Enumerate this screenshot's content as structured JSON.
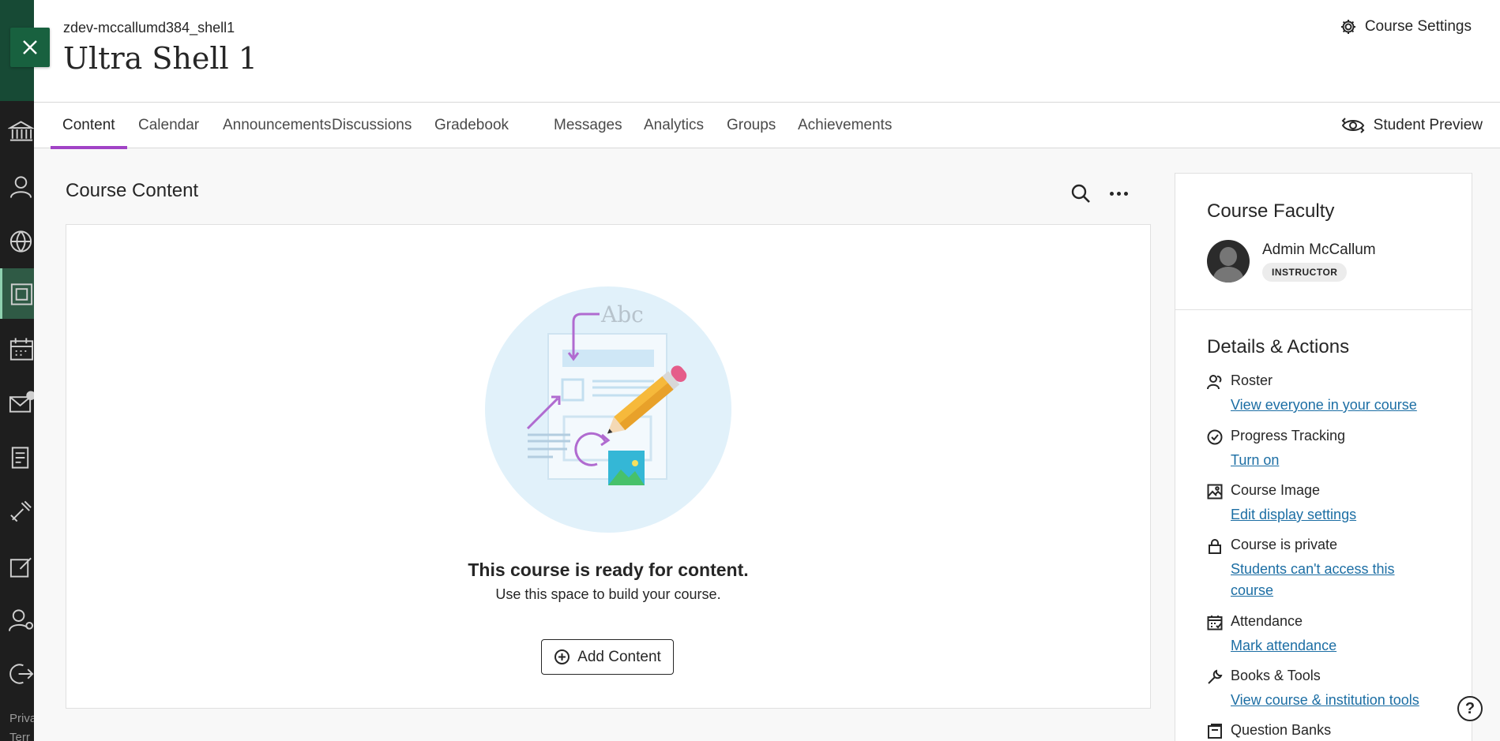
{
  "header": {
    "course_id": "zdev-mccallumd384_shell1",
    "course_title": "Ultra Shell 1",
    "settings_label": "Course Settings"
  },
  "tabs": [
    {
      "label": "Content",
      "active": true
    },
    {
      "label": "Calendar"
    },
    {
      "label": "Announcements"
    },
    {
      "label": "Discussions"
    },
    {
      "label": "Gradebook"
    },
    {
      "label": "Messages"
    },
    {
      "label": "Analytics"
    },
    {
      "label": "Groups"
    },
    {
      "label": "Achievements"
    }
  ],
  "student_preview": "Student Preview",
  "course_content": {
    "title": "Course Content",
    "illustration_text": "Abc",
    "empty_title": "This course is ready for content.",
    "empty_subtitle": "Use this space to build your course.",
    "add_button": "Add Content"
  },
  "sidebar": {
    "faculty_title": "Course Faculty",
    "faculty": {
      "name": "Admin McCallum",
      "role": "INSTRUCTOR"
    },
    "details_title": "Details & Actions",
    "items": [
      {
        "label": "Roster",
        "link": "View everyone in your course",
        "icon": "roster-icon"
      },
      {
        "label": "Progress Tracking",
        "link": "Turn on",
        "icon": "check-circle-icon"
      },
      {
        "label": "Course Image",
        "link": "Edit display settings",
        "icon": "image-icon"
      },
      {
        "label": "Course is private",
        "link": "Students can't access this course",
        "icon": "lock-icon"
      },
      {
        "label": "Attendance",
        "link": "Mark attendance",
        "icon": "calendar-check-icon"
      },
      {
        "label": "Books & Tools",
        "link": "View course & institution tools",
        "icon": "wrench-icon"
      },
      {
        "label": "Question Banks",
        "link": "",
        "icon": "question-bank-icon"
      }
    ]
  },
  "rail": {
    "footer_text_1": "Priva",
    "footer_text_2": "Terr"
  },
  "colors": {
    "accent": "#a143c6",
    "link": "#1c6ea4",
    "rail_top": "#174a35",
    "close_button": "#18613f"
  }
}
